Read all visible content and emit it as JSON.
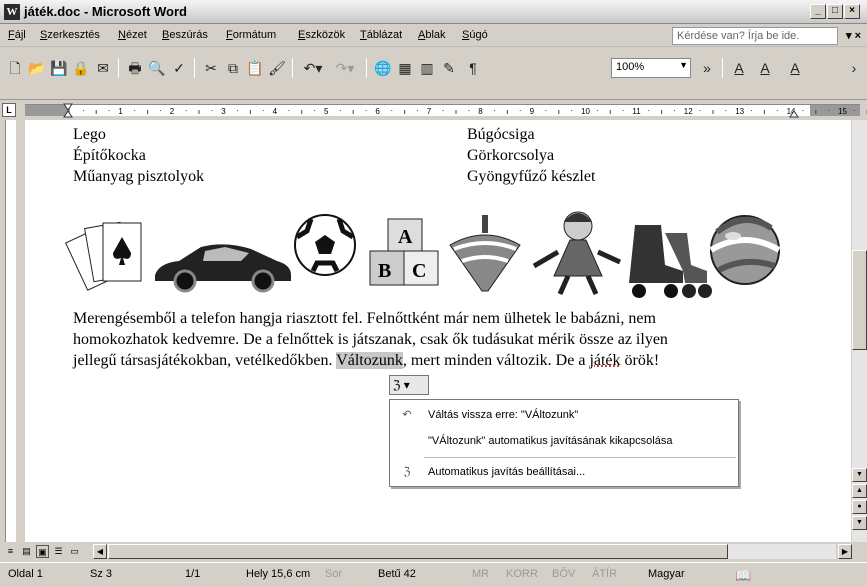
{
  "window": {
    "title": "játék.doc - Microsoft Word",
    "app_icon": "W"
  },
  "menubar": {
    "items": [
      "Fájl",
      "Szerkesztés",
      "Nézet",
      "Beszúrás",
      "Formátum",
      "Eszközök",
      "Táblázat",
      "Ablak",
      "Súgó"
    ],
    "help_placeholder": "Kérdése van? Írja be ide."
  },
  "toolbar": {
    "zoom": "100%",
    "pilcrow": "¶",
    "font_color_label": "A",
    "highlight_label": "A",
    "font_size_grow": "A"
  },
  "ruler": {
    "horizontal_ticks": [
      "1",
      "2",
      "3",
      "4",
      "5",
      "6",
      "7",
      "8",
      "9",
      "10",
      "11",
      "12",
      "13",
      "14",
      "15",
      "16",
      "17"
    ],
    "vertical_ticks": [
      "9",
      "10",
      "11",
      "12",
      "13",
      "14",
      "15",
      "16",
      "17"
    ],
    "tab_selector": "L"
  },
  "document": {
    "list_left": [
      "Lego",
      "Építőkocka",
      "Műanyag pisztolyok"
    ],
    "list_right": [
      "Búgócsiga",
      "Görkorcsolya",
      "Gyöngyfűző készlet"
    ],
    "picture_row": [
      "cards",
      "car",
      "ball",
      "blocks",
      "spinning-top",
      "doll",
      "roller-skates",
      "beach-ball"
    ],
    "paragraph": {
      "line1": "Merengésemből a telefon hangja riasztott fel. Felnőttként már nem ülhetek le babázni, nem",
      "line2": "homokozhatok kedvemre. De a felnőttek is játszanak, csak ők tudásukat mérik össze az ilyen",
      "line3_before": "jellegű társasjátékokban, vetélkedőkben. ",
      "line3_highlight": "Változunk",
      "line3_after": ", mert minden változik. De a ",
      "line3_err": "játék",
      "line3_end": " örök!"
    }
  },
  "autocorrect": {
    "smart_tag": "ℨ ▾",
    "items": [
      {
        "icon": "undo-icon",
        "glyph": "↶",
        "label": "Váltás vissza erre: \"VÁltozunk\""
      },
      {
        "icon": "none",
        "glyph": "",
        "label": "\"VÁltozunk\" automatikus javításának kikapcsolása"
      },
      {
        "icon": "autocorrect-icon",
        "glyph": "ℨ",
        "label": "Automatikus javítás beállításai..."
      }
    ]
  },
  "statusbar": {
    "page": "Oldal 1",
    "section": "Sz 3",
    "pages": "1/1",
    "position": "Hely 15,6 cm",
    "line": "Sor",
    "column": "Betű 42",
    "modes": [
      "MR",
      "KORR",
      "BŐV",
      "ÁTÍR"
    ],
    "language": "Magyar"
  },
  "colors": {
    "chrome": "#d4d0c8",
    "page": "#ffffff",
    "highlight": "#c8c8c8"
  }
}
